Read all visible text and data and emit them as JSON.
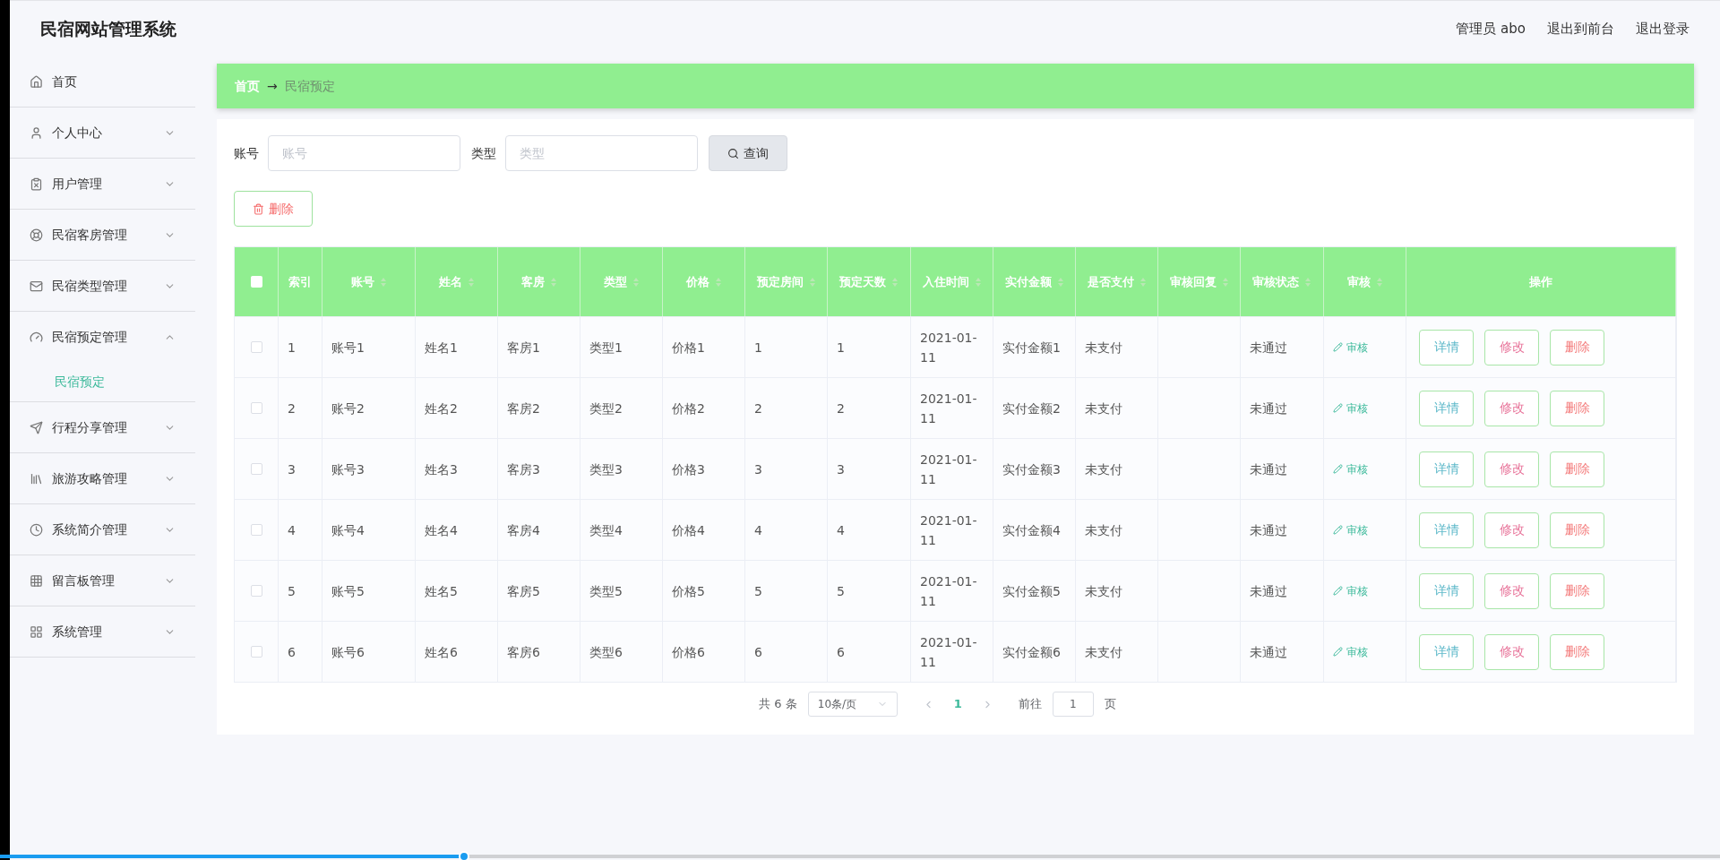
{
  "header": {
    "title": "民宿网站管理系统",
    "links": [
      "管理员 abo",
      "退出到前台",
      "退出登录"
    ]
  },
  "sidebar": {
    "items": [
      {
        "label": "首页",
        "expandable": false
      },
      {
        "label": "个人中心",
        "expandable": true,
        "expanded": false
      },
      {
        "label": "用户管理",
        "expandable": true,
        "expanded": false
      },
      {
        "label": "民宿客房管理",
        "expandable": true,
        "expanded": false
      },
      {
        "label": "民宿类型管理",
        "expandable": true,
        "expanded": false
      },
      {
        "label": "民宿预定管理",
        "expandable": true,
        "expanded": true,
        "children": [
          {
            "label": "民宿预定",
            "selected": true
          }
        ]
      },
      {
        "label": "行程分享管理",
        "expandable": true,
        "expanded": false
      },
      {
        "label": "旅游攻略管理",
        "expandable": true,
        "expanded": false
      },
      {
        "label": "系统简介管理",
        "expandable": true,
        "expanded": false
      },
      {
        "label": "留言板管理",
        "expandable": true,
        "expanded": false
      },
      {
        "label": "系统管理",
        "expandable": true,
        "expanded": false
      }
    ]
  },
  "breadcrumb": {
    "home": "首页",
    "separator": "→",
    "current": "民宿预定"
  },
  "search": {
    "fields": [
      {
        "label": "账号",
        "placeholder": "账号"
      },
      {
        "label": "类型",
        "placeholder": "类型"
      }
    ],
    "button": "查询"
  },
  "delete_button": "删除",
  "table": {
    "columns": [
      {
        "kind": "checkbox"
      },
      {
        "label": "索引",
        "kind": "text",
        "sortable": false
      },
      {
        "label": "账号",
        "kind": "text",
        "sortable": true
      },
      {
        "label": "姓名",
        "kind": "text",
        "sortable": true
      },
      {
        "label": "客房",
        "kind": "text",
        "sortable": true
      },
      {
        "label": "类型",
        "kind": "text",
        "sortable": true
      },
      {
        "label": "价格",
        "kind": "text",
        "sortable": true
      },
      {
        "label": "预定房间",
        "kind": "text",
        "sortable": true
      },
      {
        "label": "预定天数",
        "kind": "text",
        "sortable": true
      },
      {
        "label": "入住时间",
        "kind": "text",
        "sortable": true
      },
      {
        "label": "实付金额",
        "kind": "text",
        "sortable": true
      },
      {
        "label": "是否支付",
        "kind": "text",
        "sortable": true
      },
      {
        "label": "审核回复",
        "kind": "text",
        "sortable": true
      },
      {
        "label": "审核状态",
        "kind": "text",
        "sortable": true
      },
      {
        "label": "审核",
        "kind": "review",
        "sortable": true
      },
      {
        "label": "操作",
        "kind": "actions",
        "sortable": false
      }
    ],
    "all_checked": false,
    "rows": [
      {
        "checked": false,
        "cells": [
          "",
          "1",
          "账号1",
          "姓名1",
          "客房1",
          "类型1",
          "价格1",
          "1",
          "1",
          "2021-01-11",
          "实付金额1",
          "未支付",
          "",
          "未通过",
          "审核"
        ],
        "actions": [
          "详情",
          "修改",
          "删除"
        ]
      },
      {
        "checked": false,
        "cells": [
          "",
          "2",
          "账号2",
          "姓名2",
          "客房2",
          "类型2",
          "价格2",
          "2",
          "2",
          "2021-01-11",
          "实付金额2",
          "未支付",
          "",
          "未通过",
          "审核"
        ],
        "actions": [
          "详情",
          "修改",
          "删除"
        ]
      },
      {
        "checked": false,
        "cells": [
          "",
          "3",
          "账号3",
          "姓名3",
          "客房3",
          "类型3",
          "价格3",
          "3",
          "3",
          "2021-01-11",
          "实付金额3",
          "未支付",
          "",
          "未通过",
          "审核"
        ],
        "actions": [
          "详情",
          "修改",
          "删除"
        ]
      },
      {
        "checked": false,
        "cells": [
          "",
          "4",
          "账号4",
          "姓名4",
          "客房4",
          "类型4",
          "价格4",
          "4",
          "4",
          "2021-01-11",
          "实付金额4",
          "未支付",
          "",
          "未通过",
          "审核"
        ],
        "actions": [
          "详情",
          "修改",
          "删除"
        ]
      },
      {
        "checked": false,
        "cells": [
          "",
          "5",
          "账号5",
          "姓名5",
          "客房5",
          "类型5",
          "价格5",
          "5",
          "5",
          "2021-01-11",
          "实付金额5",
          "未支付",
          "",
          "未通过",
          "审核"
        ],
        "actions": [
          "详情",
          "修改",
          "删除"
        ]
      },
      {
        "checked": false,
        "cells": [
          "",
          "6",
          "账号6",
          "姓名6",
          "客房6",
          "类型6",
          "价格6",
          "6",
          "6",
          "2021-01-11",
          "实付金额6",
          "未支付",
          "",
          "未通过",
          "审核"
        ],
        "actions": [
          "详情",
          "修改",
          "删除"
        ]
      }
    ]
  },
  "pagination": {
    "total": "共 6 条",
    "page_size": "10条/页",
    "pages": [
      {
        "label": "1",
        "selected": true
      }
    ],
    "goto_label": "前往",
    "goto_value": "1",
    "goto_suffix": "页"
  },
  "video_progress": {
    "level": 0.27
  }
}
